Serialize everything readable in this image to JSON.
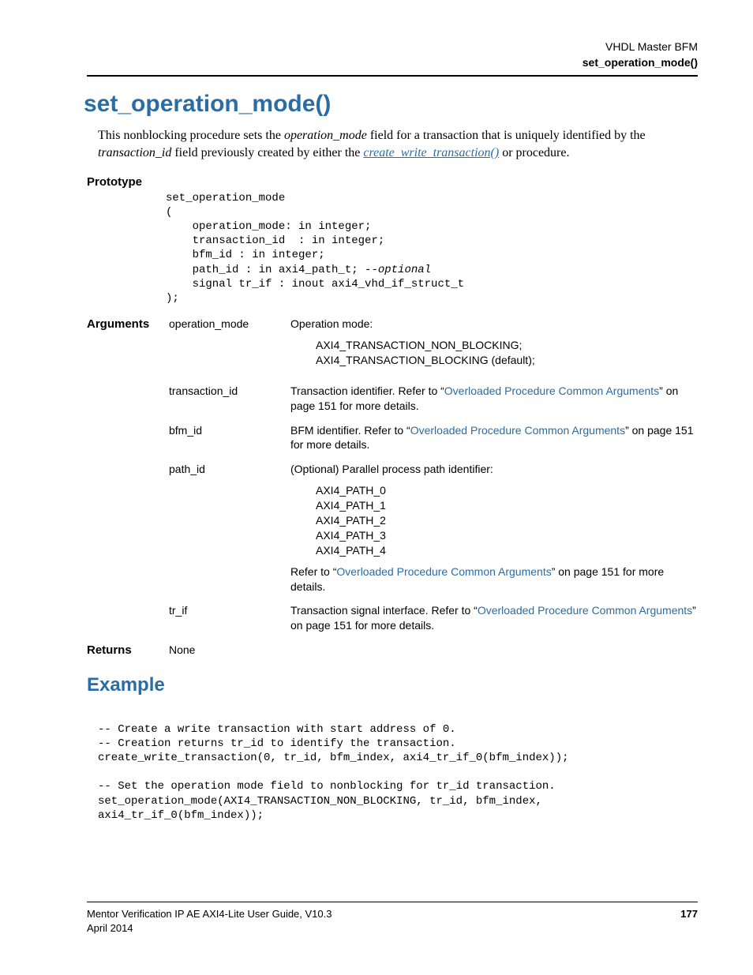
{
  "header": {
    "line1": "VHDL Master BFM",
    "line2": "set_operation_mode()"
  },
  "title": "set_operation_mode()",
  "intro": {
    "pre1": "This nonblocking procedure sets the ",
    "em1": "operation_mode",
    "mid1": " field for a transaction that is uniquely identified by the ",
    "em2": "transaction_id",
    "mid2": " field previously created by either the ",
    "link": "create_write_transaction()",
    "post": " or  procedure."
  },
  "labels": {
    "prototype": "Prototype",
    "arguments": "Arguments",
    "returns": "Returns"
  },
  "prototype": {
    "l1": "set_operation_mode",
    "l2": "(",
    "l3": "    operation_mode: in integer;",
    "l4": "    transaction_id  : in integer;",
    "l5": "    bfm_id : in integer;",
    "l6a": "    path_id : in axi4_path_t; ",
    "l6b": "--optional",
    "l7": "    signal tr_if : inout axi4_vhd_if_struct_t",
    "l8": ");"
  },
  "args": {
    "operation_mode": {
      "name": "operation_mode",
      "lead": "Operation mode:",
      "v1": "AXI4_TRANSACTION_NON_BLOCKING;",
      "v2": "AXI4_TRANSACTION_BLOCKING (default);"
    },
    "transaction_id": {
      "name": "transaction_id",
      "pre": "Transaction identifier. Refer to “",
      "link": "Overloaded Procedure Common Arguments",
      "post": "” on page 151 for more details."
    },
    "bfm_id": {
      "name": "bfm_id",
      "pre": "BFM identifier. Refer to “",
      "link": "Overloaded Procedure Common Arguments",
      "post": "” on page 151 for more details."
    },
    "path_id": {
      "name": "path_id",
      "lead": "(Optional) Parallel process path identifier:",
      "v1": "AXI4_PATH_0",
      "v2": "AXI4_PATH_1",
      "v3": "AXI4_PATH_2",
      "v4": "AXI4_PATH_3",
      "v5": "AXI4_PATH_4",
      "refer_pre": "Refer to “",
      "refer_link": "Overloaded Procedure Common Arguments",
      "refer_post": "” on page 151 for more details."
    },
    "tr_if": {
      "name": "tr_if",
      "pre": "Transaction signal interface. Refer to “",
      "link": "Overloaded Procedure Common Arguments",
      "post": "” on page 151 for more details."
    }
  },
  "returns": "None",
  "example": {
    "heading": "Example",
    "l1": "-- Create a write transaction with start address of 0.",
    "l2": "-- Creation returns tr_id to identify the transaction.",
    "l3": "create_write_transaction(0, tr_id, bfm_index, axi4_tr_if_0(bfm_index));",
    "l4": "",
    "l5": "-- Set the operation mode field to nonblocking for tr_id transaction.",
    "l6": "set_operation_mode(AXI4_TRANSACTION_NON_BLOCKING, tr_id, bfm_index,",
    "l7": "axi4_tr_if_0(bfm_index));"
  },
  "footer": {
    "left1": "Mentor Verification IP AE AXI4-Lite User Guide, V10.3",
    "left2": "April 2014",
    "page": "177"
  }
}
